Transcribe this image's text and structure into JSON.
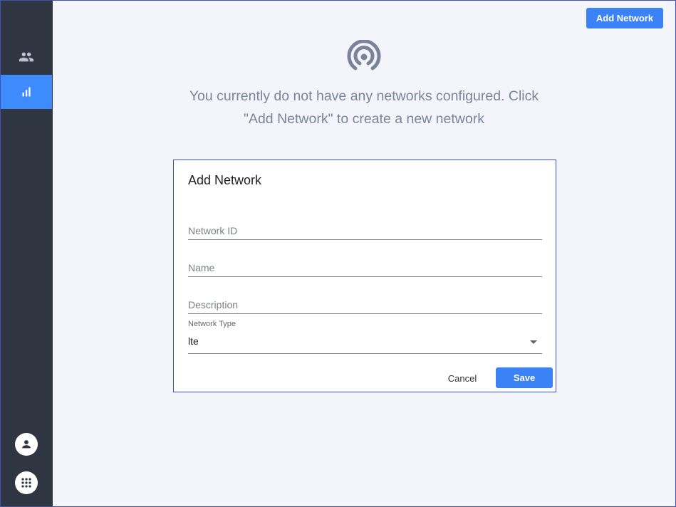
{
  "header": {
    "add_network_label": "Add Network"
  },
  "sidebar": {
    "items": [
      {
        "icon": "people-icon",
        "active": false
      },
      {
        "icon": "bar-chart-icon",
        "active": true
      }
    ],
    "bottom": [
      {
        "icon": "account-icon"
      },
      {
        "icon": "apps-grid-icon"
      }
    ]
  },
  "empty_state": {
    "icon": "signal-broadcast-icon",
    "message_line1": "You currently do not have any networks configured. Click",
    "message_line2": "\"Add Network\" to create a new network"
  },
  "dialog": {
    "title": "Add Network",
    "fields": [
      {
        "placeholder": "Network ID",
        "value": ""
      },
      {
        "placeholder": "Name",
        "value": ""
      },
      {
        "placeholder": "Description",
        "value": ""
      }
    ],
    "network_type": {
      "label": "Network Type",
      "value": "lte"
    },
    "cancel_label": "Cancel",
    "save_label": "Save"
  },
  "colors": {
    "sidebar_bg": "#2f3541",
    "accent": "#3b82f6",
    "page_bg": "#f4f5fa",
    "muted_text": "#7a8399"
  }
}
